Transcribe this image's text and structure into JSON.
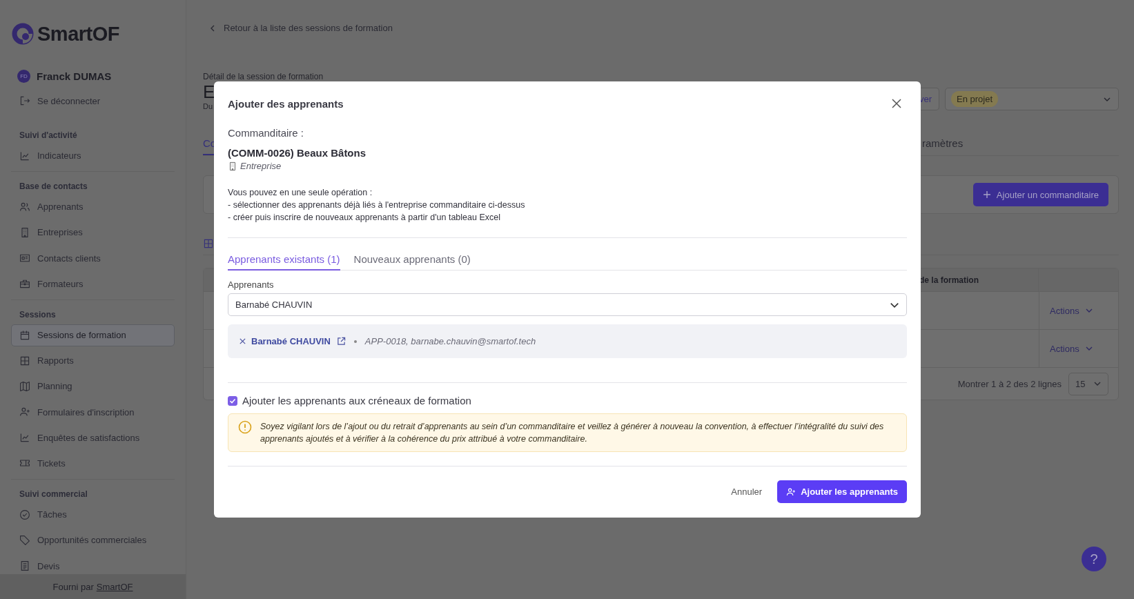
{
  "sidebar": {
    "logo": "SmartOF",
    "user": {
      "initials": "FD",
      "name": "Franck DUMAS"
    },
    "logout": "Se déconnecter",
    "sections": [
      {
        "title": "Suivi d'activité",
        "items": [
          {
            "label": "Indicateurs",
            "selected": false
          }
        ]
      },
      {
        "title": "Base de contacts",
        "items": [
          {
            "label": "Apprenants",
            "selected": false
          },
          {
            "label": "Entreprises",
            "selected": false
          },
          {
            "label": "Contacts clients",
            "selected": false
          },
          {
            "label": "Formateurs",
            "selected": false
          }
        ]
      },
      {
        "title": "Sessions",
        "items": [
          {
            "label": "Sessions de formation",
            "selected": true
          },
          {
            "label": "Rapports",
            "selected": false
          },
          {
            "label": "Planning",
            "selected": false
          },
          {
            "label": "Formulaires d'inscription",
            "selected": false
          },
          {
            "label": "Enquêtes de satisfactions",
            "selected": false
          },
          {
            "label": "Tickets",
            "selected": false
          }
        ]
      },
      {
        "title": "Suivi commercial",
        "items": [
          {
            "label": "Tâches",
            "selected": false
          },
          {
            "label": "Opportunités commerciales",
            "selected": false
          },
          {
            "label": "Devis",
            "selected": false
          }
        ]
      }
    ],
    "footer": {
      "text": "Fourni par",
      "link": "SmartOF"
    }
  },
  "page": {
    "back_link": "Retour à la liste des sessions de formation",
    "subtitle": "Détail de la session de formation",
    "title": "E",
    "dates": "Du",
    "button_fragment": "ver",
    "status": "En projet",
    "tabs": [
      {
        "label": "Co",
        "selected": true
      },
      {
        "label": "ramètres",
        "selected": false
      }
    ],
    "add_sponsor_button": "Ajouter un commanditaire",
    "table": {
      "column": "de la formation",
      "rows": [
        {
          "action": "Actions"
        },
        {
          "action": "Actions"
        }
      ],
      "pagination": "Montrer 1 à 2 des 2 lignes",
      "page_size": "15"
    }
  },
  "help_button": "?",
  "modal": {
    "title": "Ajouter des apprenants",
    "sponsor_label": "Commanditaire :",
    "sponsor_name": "(COMM-0026) Beaux Bâtons",
    "sponsor_type": "Entreprise",
    "intro": [
      "Vous pouvez en une seule opération :",
      "- sélectionner des apprenants déjà liés à l'entreprise commanditaire ci-dessus",
      "- créer puis inscrire de nouveaux apprenants à partir d'un tableau Excel"
    ],
    "tabs": [
      {
        "label": "Apprenants existants (1)",
        "selected": true
      },
      {
        "label": "Nouveaux apprenants (0)",
        "selected": false
      }
    ],
    "field_label": "Apprenants",
    "field_value": "Barnabé CHAUVIN",
    "selected_learners": [
      {
        "name": "Barnabé CHAUVIN",
        "details": "APP-0018, barnabe.chauvin@smartof.tech"
      }
    ],
    "checkbox": {
      "label": "Ajouter les apprenants aux créneaux de formation",
      "checked": true
    },
    "warning": "Soyez vigilant lors de l’ajout ou du retrait d’apprenants au sein d’un commanditaire et veillez à générer à nouveau la convention, à effectuer l’intégralité du suivi des apprenants ajoutés et à vérifier à la cohérence du prix attribué à votre commanditaire.",
    "cancel": "Annuler",
    "submit": "Ajouter les apprenants"
  }
}
